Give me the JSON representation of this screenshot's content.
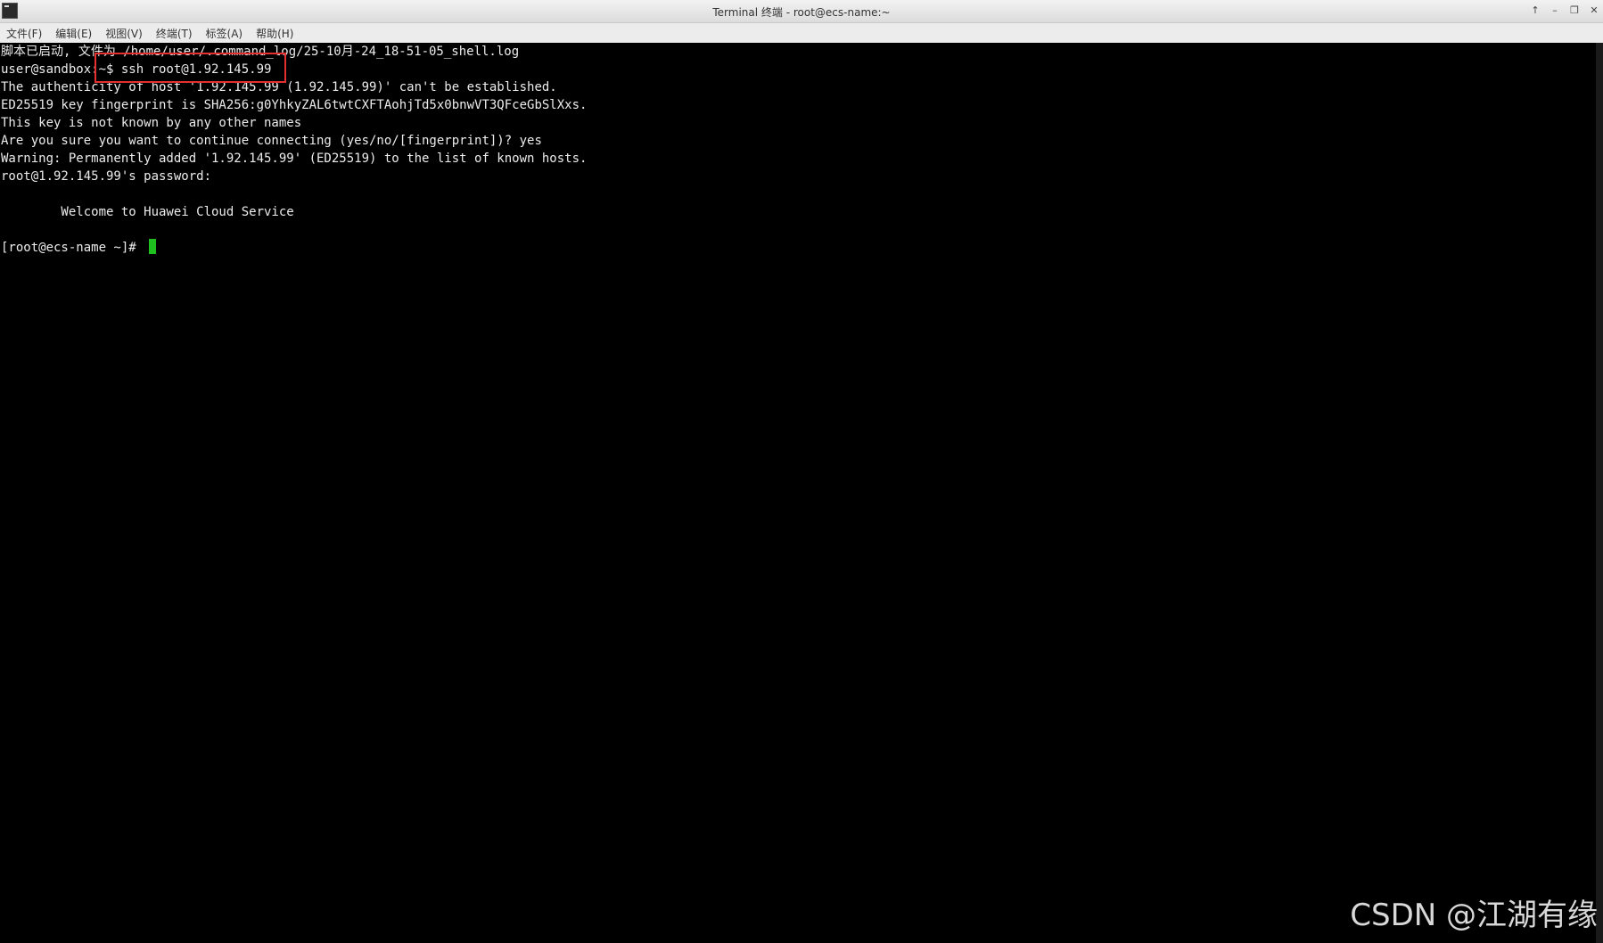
{
  "window": {
    "title": "Terminal 终端 - root@ecs-name:~"
  },
  "menu": {
    "items": [
      "文件(F)",
      "编辑(E)",
      "视图(V)",
      "终端(T)",
      "标签(A)",
      "帮助(H)"
    ]
  },
  "window_controls": {
    "up": "↑",
    "minimize": "–",
    "restore": "❐",
    "close": "✕"
  },
  "terminal": {
    "lines": [
      "脚本已启动, 文件为 /home/user/.command_log/25-10月-24_18-51-05_shell.log",
      "user@sandbox:~$ ssh root@1.92.145.99",
      "The authenticity of host '1.92.145.99 (1.92.145.99)' can't be established.",
      "ED25519 key fingerprint is SHA256:g0YhkyZAL6twtCXFTAohjTd5x0bnwVT3QFceGbSlXxs.",
      "This key is not known by any other names",
      "Are you sure you want to continue connecting (yes/no/[fingerprint])? yes",
      "Warning: Permanently added '1.92.145.99' (ED25519) to the list of known hosts.",
      "root@1.92.145.99's password:",
      "",
      "        Welcome to Huawei Cloud Service",
      "",
      "[root@ecs-name ~]# "
    ],
    "cursor_color": "#1fbf1f"
  },
  "annotation": {
    "highlight_color": "#e53030"
  },
  "watermark": "CSDN @江湖有缘"
}
